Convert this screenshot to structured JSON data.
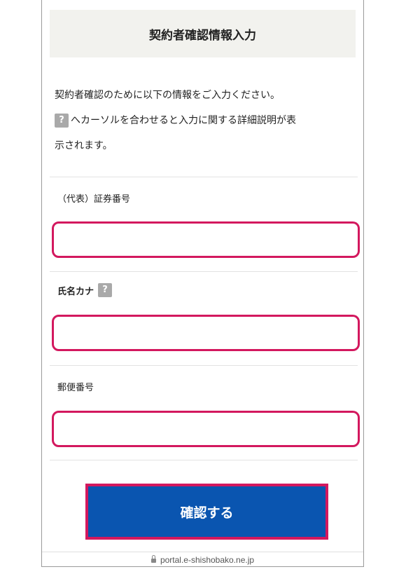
{
  "header": {
    "title": "契約者確認情報入力"
  },
  "intro": {
    "line1": "契約者確認のために以下の情報をご入力ください。",
    "help_icon": "?",
    "line2": "へカーソルを合わせると入力に関する詳細説明が表",
    "line3": "示されます。"
  },
  "form": {
    "securities_number_label": "（代表）証券番号",
    "securities_number_value": "",
    "name_kana_label": "氏名カナ",
    "name_kana_help": "?",
    "name_kana_value": "",
    "postal_code_label": "郵便番号",
    "postal_code_value": ""
  },
  "submit": {
    "label": "確認する"
  },
  "browser": {
    "url": "portal.e-shishobako.ne.jp"
  },
  "colors": {
    "accent": "#d3185e",
    "button": "#0a55b0",
    "header_bg": "#f2f2ee"
  }
}
